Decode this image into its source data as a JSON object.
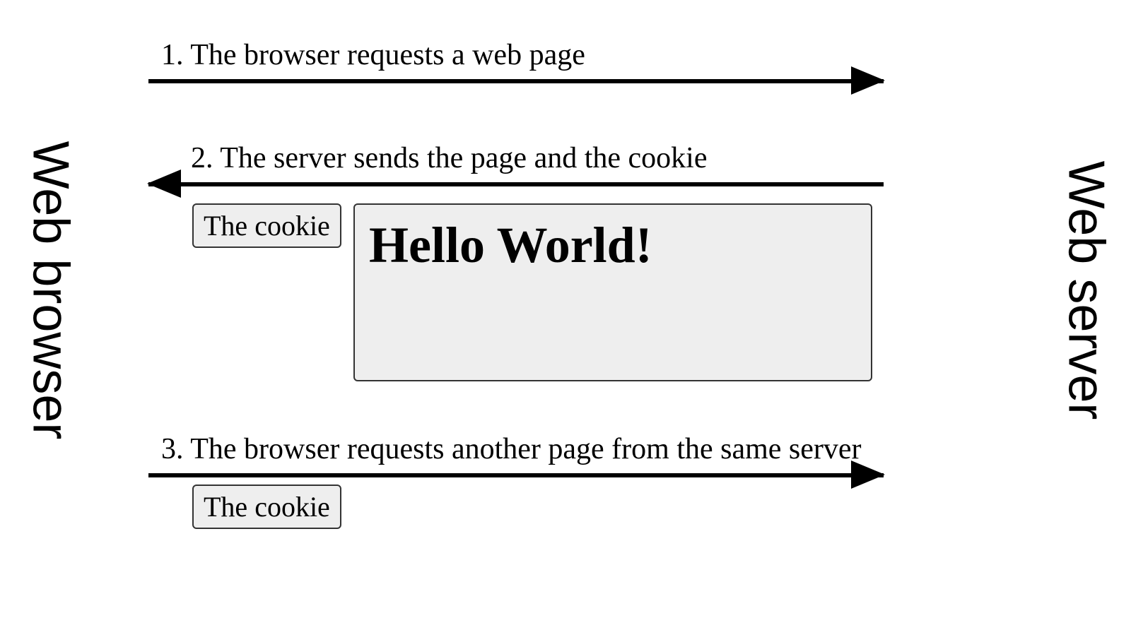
{
  "labels": {
    "browser": "Web browser",
    "server": "Web server"
  },
  "steps": {
    "one": "1. The browser requests a web page",
    "two": "2. The server sends the page and the cookie",
    "three": "3. The browser requests another page from the same server"
  },
  "boxes": {
    "cookie": "The cookie",
    "page_title": "Hello World!"
  }
}
